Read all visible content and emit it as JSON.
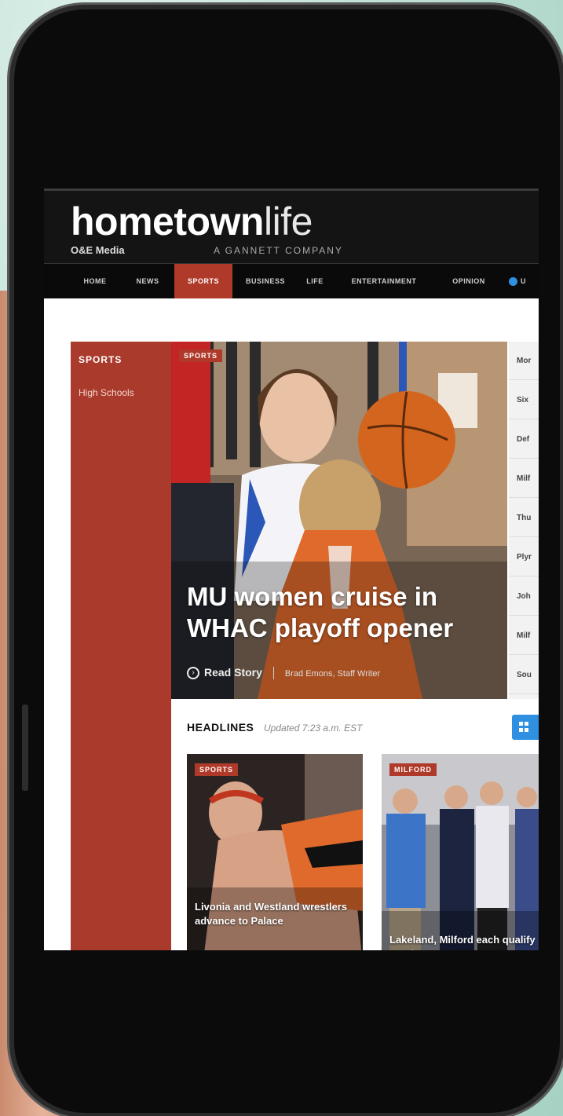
{
  "site": {
    "logo_bold": "hometown",
    "logo_light": "life",
    "publisher": "O&E Media",
    "parent": "A GANNETT COMPANY"
  },
  "nav": {
    "items": [
      {
        "label": "HOME"
      },
      {
        "label": "NEWS"
      },
      {
        "label": "SPORTS",
        "active": true
      },
      {
        "label": "BUSINESS"
      },
      {
        "label": "LIFE"
      },
      {
        "label": "ENTERTAINMENT"
      },
      {
        "label": "OPINION"
      },
      {
        "label": "U"
      }
    ]
  },
  "sidebar": {
    "title": "SPORTS",
    "links": [
      "High Schools"
    ]
  },
  "hero": {
    "tag": "SPORTS",
    "headline": "MU women cruise in WHAC playoff opener",
    "read_label": "Read Story",
    "author": "Brad Emons, Staff Writer"
  },
  "rail": {
    "items": [
      "Mor",
      "Six",
      "Def",
      "Milf",
      "Thu",
      "Plyr",
      "Joh",
      "Milf",
      "Sou"
    ]
  },
  "headlines": {
    "title": "HEADLINES",
    "updated": "Updated 7:23 a.m. EST"
  },
  "cards": [
    {
      "tag": "SPORTS",
      "title": "Livonia and Westland wrestlers advance to Palace"
    },
    {
      "tag": "MILFORD",
      "title": "Lakeland, Milford each qualify two for states"
    }
  ],
  "colors": {
    "accent": "#b03a2a",
    "header_bg": "#141414",
    "nav_highlight": "#2f8fe0"
  }
}
